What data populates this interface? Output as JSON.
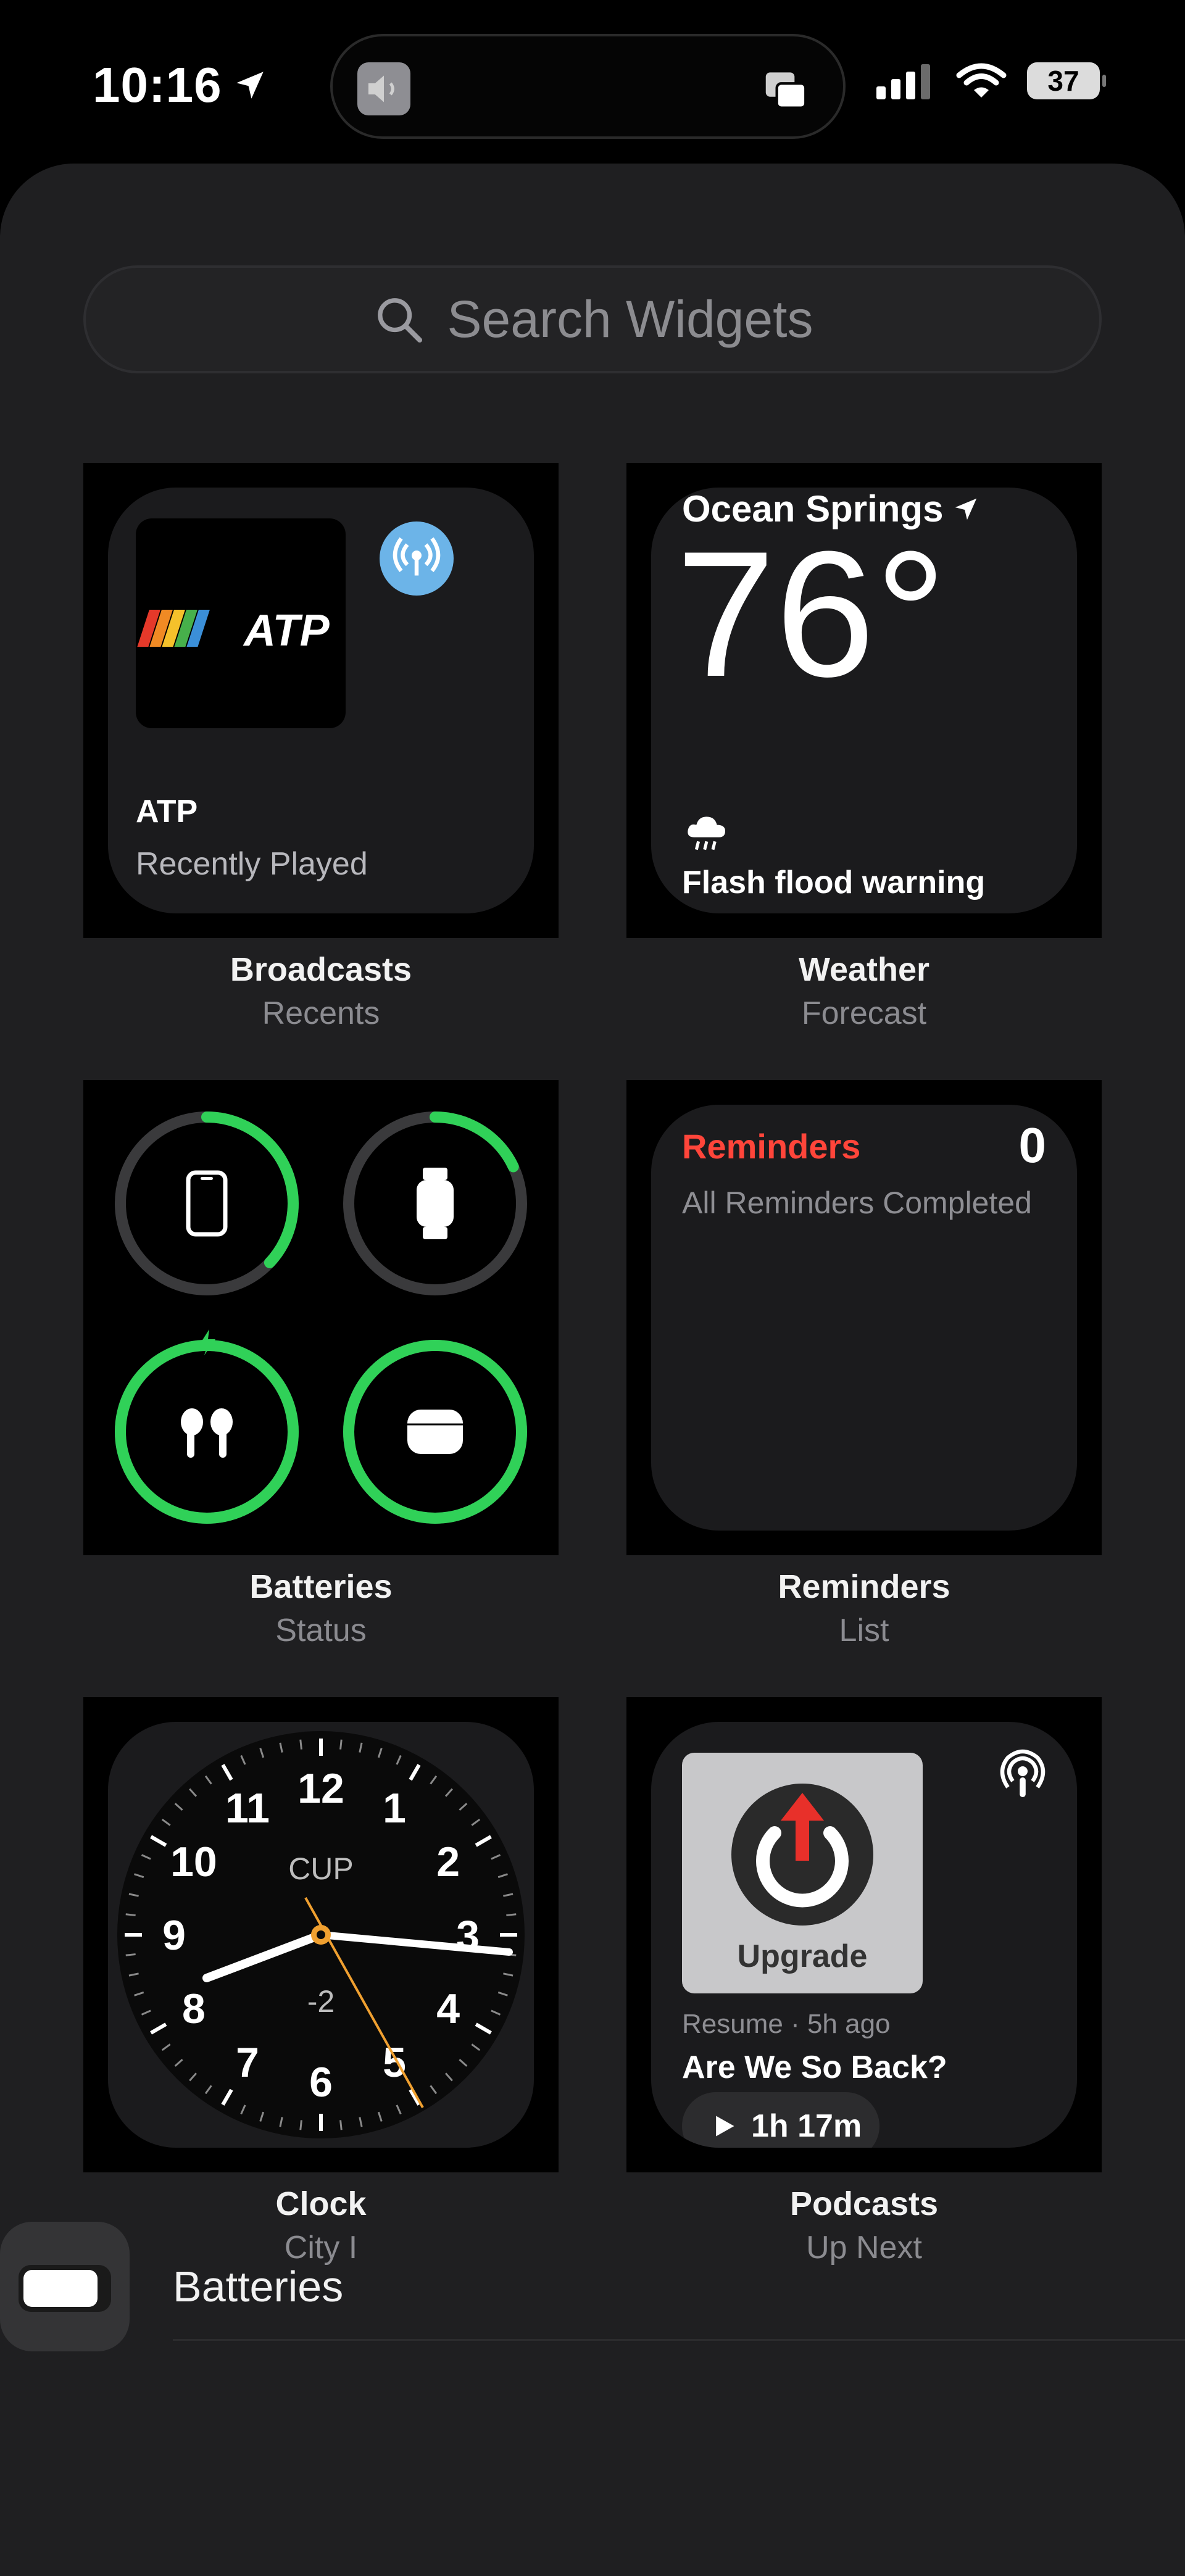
{
  "status_bar": {
    "time": "10:16",
    "battery": "37",
    "icons": [
      "location-arrow-icon",
      "volume-icon",
      "screen-cast-icon",
      "cellular-signal-icon",
      "wifi-icon",
      "battery-icon"
    ]
  },
  "search": {
    "placeholder": "Search Widgets"
  },
  "widgets": [
    {
      "id": "broadcasts",
      "caption_title": "Broadcasts",
      "caption_sub": "Recents",
      "title": "ATP",
      "subtitle": "Recently Played",
      "artwork_text": "ATP"
    },
    {
      "id": "weather",
      "caption_title": "Weather",
      "caption_sub": "Forecast",
      "location": "Ocean Springs",
      "temperature": "76°",
      "condition": "Flash flood warning"
    },
    {
      "id": "batteries",
      "caption_title": "Batteries",
      "caption_sub": "Status",
      "devices": [
        {
          "name": "iphone-icon",
          "level": 0.37
        },
        {
          "name": "watch-icon",
          "level": 0.18
        },
        {
          "name": "airpods-icon",
          "level": 1.0,
          "charging": true
        },
        {
          "name": "airpods-case-icon",
          "level": 1.0
        }
      ]
    },
    {
      "id": "reminders",
      "caption_title": "Reminders",
      "caption_sub": "List",
      "title": "Reminders",
      "count": "0",
      "status": "All Reminders Completed"
    },
    {
      "id": "clock",
      "caption_title": "Clock",
      "caption_sub": "City I",
      "city_code": "CUP",
      "offset": "-2",
      "numerals": [
        "12",
        "1",
        "2",
        "3",
        "4",
        "5",
        "6",
        "7",
        "8",
        "9",
        "10",
        "11"
      ]
    },
    {
      "id": "podcasts",
      "caption_title": "Podcasts",
      "caption_sub": "Up Next",
      "show": "Upgrade",
      "meta": "Resume · 5h ago",
      "episode": "Are We So Back?",
      "duration": "1h 17m"
    }
  ],
  "bottom": {
    "label": "Batteries"
  },
  "colors": {
    "ring_green": "#30d158",
    "reminders_red": "#ff453a",
    "clock_second_hand": "#f0a030"
  }
}
